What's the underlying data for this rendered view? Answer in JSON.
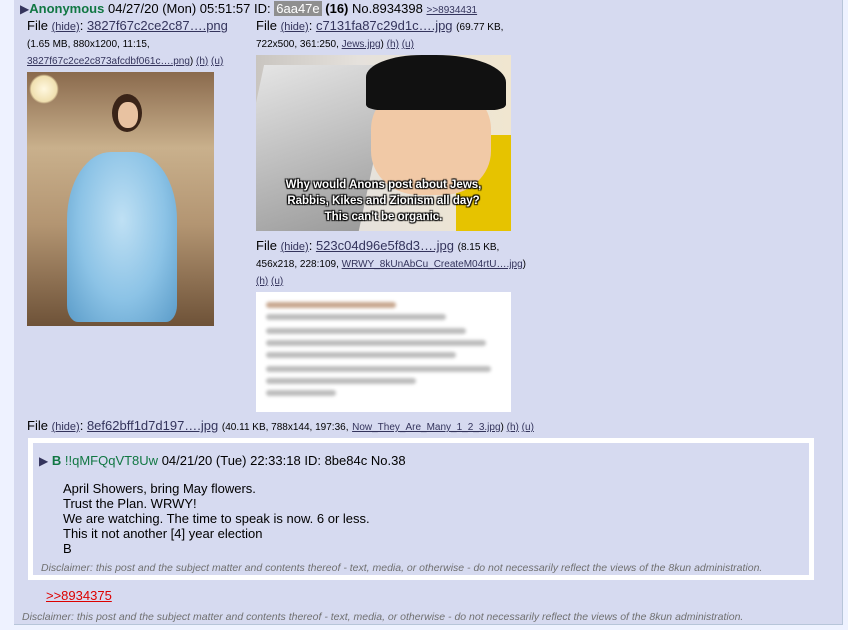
{
  "post": {
    "arrow": "▶",
    "name": "Anonymous",
    "datetime": "04/27/20 (Mon) 05:51:57",
    "id_label": "ID:",
    "id": "6aa47e",
    "id_count": "(16)",
    "number": "No.8934398",
    "reply_link": ">>8934431",
    "files": [
      {
        "label": "File",
        "hide": "(hide)",
        "filename": "3827f67c2ce2c87….png",
        "meta_line1": "(1.65 MB, 880x1200, 11:15,",
        "orig_name": "3827f67c2ce2c873afcdbf061c….png",
        "meta_end": ")",
        "h": "(h)",
        "u": "(u)"
      },
      {
        "label": "File",
        "hide": "(hide)",
        "filename": "c7131fa87c29d1c….jpg",
        "meta_a": "(69.77 KB,",
        "meta_b": "722x500, 361:250,",
        "orig_name": "Jews.jpg",
        "meta_end": ")",
        "h": "(h)",
        "u": "(u)",
        "image_caption": [
          "Why would Anons post about Jews,",
          "Rabbis, Kikes and Zionism all day?",
          "This can't be organic."
        ]
      },
      {
        "label": "File",
        "hide": "(hide)",
        "filename": "523c04d96e5f8d3….jpg",
        "meta_a": "(8.15 KB,",
        "meta_b": "456x218, 228:109,",
        "orig_name": "WRWY_8kUnAbCu_CreateM04rtU….jpg",
        "meta_end": ")",
        "h": "(h)",
        "u": "(u)"
      },
      {
        "label": "File",
        "hide": "(hide)",
        "filename": "8ef62bff1d7d197….jpg",
        "meta": "(40.11 KB, 788x144, 197:36,",
        "orig_name": "Now_They_Are_Many_1_2_3.jpg",
        "meta_end": ")",
        "h": "(h)",
        "u": "(u)"
      }
    ],
    "quoted": {
      "arrow": "▶",
      "name": "B",
      "tripcode": "!!qMFQqVT8Uw",
      "datetime": "04/21/20 (Tue) 22:33:18",
      "id_label": "ID:",
      "id": "8be84c",
      "number": "No.38",
      "lines": [
        "April Showers, bring May flowers.",
        "Trust the Plan. WRWY!",
        "We are watching. The time to speak is now. 6 or less.",
        "This it not another [4] year election",
        "B"
      ],
      "disclaimer": "Disclaimer: this post and the subject matter and contents thereof - text, media, or otherwise - do not necessarily reflect the views of the 8kun administration."
    },
    "backlink": ">>8934375",
    "disclaimer": "Disclaimer: this post and the subject matter and contents thereof - text, media, or otherwise - do not necessarily reflect the views of the 8kun administration."
  }
}
